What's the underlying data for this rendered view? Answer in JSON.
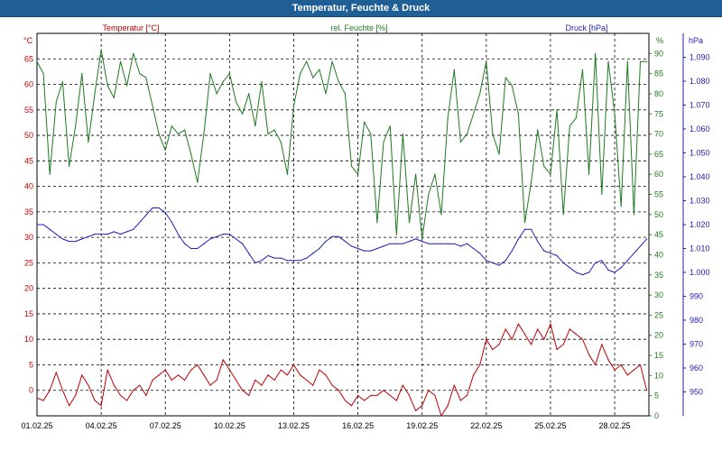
{
  "window": {
    "title": "Temperatur, Feuchte & Druck",
    "title_bg": "#1f5f96"
  },
  "chart_data": {
    "type": "line",
    "x_tick_labels": [
      "01.02.25",
      "04.02.25",
      "07.02.25",
      "10.02.25",
      "13.02.25",
      "16.02.25",
      "19.02.25",
      "22.02.25",
      "25.02.25",
      "28.02.25"
    ],
    "x_range_days": [
      0,
      28.6
    ],
    "grid": true,
    "axes": [
      {
        "id": "temp",
        "side": "left",
        "label": "Temperatur [°C]",
        "unit": "°C",
        "color": "#c00000",
        "ylim": [
          -5,
          70
        ],
        "ticks": [
          0,
          5,
          10,
          15,
          20,
          25,
          30,
          35,
          40,
          45,
          50,
          55,
          60,
          65
        ]
      },
      {
        "id": "hum",
        "side": "right",
        "label": "rel. Feuchte [%]",
        "unit": "%",
        "color": "#1f7a1f",
        "ylim": [
          0,
          95
        ],
        "ticks": [
          0,
          5,
          10,
          15,
          20,
          25,
          30,
          35,
          40,
          45,
          50,
          55,
          60,
          65,
          70,
          75,
          80,
          85,
          90
        ]
      },
      {
        "id": "press",
        "side": "right",
        "label": "Druck [hPa]",
        "unit": "hPa",
        "color": "#1f1fb4",
        "ylim": [
          940,
          1100
        ],
        "ticks": [
          950,
          960,
          970,
          980,
          990,
          1000,
          1010,
          1020,
          1030,
          1040,
          1050,
          1060,
          1070,
          1080,
          1090
        ]
      }
    ],
    "series": [
      {
        "name": "Temperatur [°C]",
        "axis": "temp",
        "color": "#c00000",
        "x": [
          0,
          0.3,
          0.6,
          0.9,
          1.2,
          1.5,
          1.8,
          2.1,
          2.4,
          2.7,
          3,
          3.3,
          3.6,
          3.9,
          4.2,
          4.5,
          4.8,
          5.1,
          5.4,
          5.7,
          6,
          6.3,
          6.6,
          6.9,
          7.2,
          7.5,
          7.8,
          8.1,
          8.4,
          8.7,
          9,
          9.3,
          9.6,
          9.9,
          10.2,
          10.5,
          10.8,
          11.1,
          11.4,
          11.7,
          12,
          12.3,
          12.6,
          12.9,
          13.2,
          13.5,
          13.8,
          14.1,
          14.4,
          14.7,
          15,
          15.3,
          15.6,
          15.9,
          16.2,
          16.5,
          16.8,
          17.1,
          17.4,
          17.7,
          18,
          18.3,
          18.6,
          18.9,
          19.2,
          19.5,
          19.8,
          20.1,
          20.4,
          20.7,
          21,
          21.3,
          21.6,
          21.9,
          22.2,
          22.5,
          22.8,
          23.1,
          23.4,
          23.7,
          24,
          24.3,
          24.6,
          24.9,
          25.2,
          25.5,
          25.8,
          26.1,
          26.4,
          26.7,
          27,
          27.3,
          27.6,
          27.9,
          28.2,
          28.5
        ],
        "values": [
          -1.5,
          -2,
          0,
          3.5,
          0,
          -3,
          -1,
          3,
          1,
          -2,
          -3,
          4,
          1,
          -1,
          -2,
          0,
          1,
          -1,
          2,
          3,
          4,
          2,
          3,
          2,
          4,
          5,
          3,
          1,
          2,
          6,
          4,
          2,
          0,
          -1,
          2,
          1,
          3,
          2,
          4,
          3,
          5,
          3,
          2,
          1,
          4,
          3,
          1,
          0,
          -2,
          -3,
          -1,
          -2,
          -1,
          -1,
          0,
          -1,
          -2,
          1,
          -1,
          -4,
          -3,
          0,
          -1,
          -5,
          -3,
          1,
          -2,
          -1,
          3,
          5,
          10,
          8,
          9,
          12,
          10,
          13,
          11,
          9,
          12,
          10,
          13,
          8,
          9,
          12,
          11,
          10,
          7,
          5,
          9,
          6,
          4,
          5,
          3,
          4,
          5,
          0
        ],
        "point_labels": [
          "-1.5",
          "-2",
          "0",
          "3.5",
          "0",
          "-3",
          "-1",
          "3",
          "1",
          "-2",
          "-3",
          "4",
          "1",
          "-1",
          "-2",
          "0",
          "1",
          "-1",
          "2",
          "3",
          "4",
          "2",
          "3",
          "2",
          "4",
          "5",
          "3",
          "1",
          "2",
          "6",
          "4",
          "2",
          "0",
          "-1",
          "2",
          "1",
          "3",
          "2",
          "4",
          "3",
          "5",
          "3",
          "2",
          "1",
          "4",
          "3",
          "1",
          "0",
          "-2",
          "-3",
          "-1",
          "-2",
          "-1",
          "-1",
          "0",
          "-1",
          "-2",
          "1",
          "-1",
          "-4",
          "-3",
          "0",
          "-1",
          "-5",
          "-3",
          "1",
          "-2",
          "-1",
          "3",
          "5",
          "10",
          "8",
          "9",
          "12",
          "10",
          "13",
          "11",
          "9",
          "12",
          "10",
          "13",
          "8",
          "9",
          "12",
          "11",
          "10",
          "7",
          "5",
          "9",
          "6",
          "4",
          "5",
          "3",
          "4",
          "5",
          "0"
        ]
      },
      {
        "name": "rel. Feuchte [%]",
        "axis": "hum",
        "color": "#1f7a1f",
        "x": [
          0,
          0.3,
          0.6,
          0.9,
          1.2,
          1.5,
          1.8,
          2.1,
          2.4,
          2.7,
          3,
          3.3,
          3.6,
          3.9,
          4.2,
          4.5,
          4.8,
          5.1,
          5.4,
          5.7,
          6,
          6.3,
          6.6,
          6.9,
          7.2,
          7.5,
          7.8,
          8.1,
          8.4,
          8.7,
          9,
          9.3,
          9.6,
          9.9,
          10.2,
          10.5,
          10.8,
          11.1,
          11.4,
          11.7,
          12,
          12.3,
          12.6,
          12.9,
          13.2,
          13.5,
          13.8,
          14.1,
          14.4,
          14.7,
          15,
          15.3,
          15.6,
          15.9,
          16.2,
          16.5,
          16.8,
          17.1,
          17.4,
          17.7,
          18,
          18.3,
          18.6,
          18.9,
          19.2,
          19.5,
          19.8,
          20.1,
          20.4,
          20.7,
          21,
          21.3,
          21.6,
          21.9,
          22.2,
          22.5,
          22.8,
          23.1,
          23.4,
          23.7,
          24,
          24.3,
          24.6,
          24.9,
          25.2,
          25.5,
          25.8,
          26.1,
          26.4,
          26.7,
          27,
          27.3,
          27.6,
          27.9,
          28.2,
          28.5
        ],
        "values": [
          88,
          85,
          60,
          78,
          83,
          62,
          72,
          85,
          68,
          80,
          91,
          82,
          79,
          88,
          82,
          90,
          85,
          84,
          77,
          70,
          66,
          72,
          70,
          71,
          65,
          58,
          70,
          85,
          80,
          83,
          85,
          78,
          75,
          80,
          72,
          83,
          70,
          71,
          68,
          60,
          77,
          85,
          88,
          84,
          86,
          80,
          88,
          83,
          80,
          62,
          60,
          73,
          70,
          48,
          68,
          72,
          45,
          70,
          48,
          60,
          44,
          55,
          60,
          50,
          74,
          86,
          68,
          70,
          75,
          80,
          88,
          70,
          65,
          84,
          82,
          75,
          48,
          58,
          71,
          62,
          60,
          76,
          50,
          72,
          74,
          86,
          60,
          90,
          55,
          88,
          75,
          52,
          88,
          50,
          88,
          88
        ],
        "point_labels": [
          "88",
          "85",
          "60",
          "78",
          "83",
          "62",
          "72",
          "85",
          "68",
          "80",
          "91",
          "82",
          "79",
          "88",
          "82",
          "90",
          "85",
          "84",
          "77",
          "70",
          "66",
          "72",
          "70",
          "71",
          "65",
          "58",
          "70",
          "85",
          "80",
          "83",
          "85",
          "78",
          "75",
          "80",
          "72",
          "83",
          "70",
          "71",
          "68",
          "60",
          "77",
          "85",
          "88",
          "84",
          "86",
          "80",
          "88",
          "83",
          "80",
          "62",
          "60",
          "73",
          "70",
          "48",
          "68",
          "72",
          "45",
          "70",
          "48",
          "60",
          "44",
          "55",
          "60",
          "50",
          "74",
          "86",
          "68",
          "70",
          "75",
          "80",
          "88",
          "70",
          "65",
          "84",
          "82",
          "75",
          "48",
          "58",
          "71",
          "62",
          "60",
          "76",
          "50",
          "72",
          "74",
          "86",
          "60",
          "90",
          "55",
          "88",
          "75",
          "52",
          "88",
          "50",
          "88",
          "88"
        ]
      },
      {
        "name": "Druck [hPa]",
        "axis": "press",
        "color": "#1f1fb4",
        "x": [
          0,
          0.3,
          0.6,
          0.9,
          1.2,
          1.5,
          1.8,
          2.1,
          2.4,
          2.7,
          3,
          3.3,
          3.6,
          3.9,
          4.2,
          4.5,
          4.8,
          5.1,
          5.4,
          5.7,
          6,
          6.3,
          6.6,
          6.9,
          7.2,
          7.5,
          7.8,
          8.1,
          8.4,
          8.7,
          9,
          9.3,
          9.6,
          9.9,
          10.2,
          10.5,
          10.8,
          11.1,
          11.4,
          11.7,
          12,
          12.3,
          12.6,
          12.9,
          13.2,
          13.5,
          13.8,
          14.1,
          14.4,
          14.7,
          15,
          15.3,
          15.6,
          15.9,
          16.2,
          16.5,
          16.8,
          17.1,
          17.4,
          17.7,
          18,
          18.3,
          18.6,
          18.9,
          19.2,
          19.5,
          19.8,
          20.1,
          20.4,
          20.7,
          21,
          21.3,
          21.6,
          21.9,
          22.2,
          22.5,
          22.8,
          23.1,
          23.4,
          23.7,
          24,
          24.3,
          24.6,
          24.9,
          25.2,
          25.5,
          25.8,
          26.1,
          26.4,
          26.7,
          27,
          27.3,
          27.6,
          27.9,
          28.2,
          28.5
        ],
        "values": [
          1020,
          1020,
          1018,
          1016,
          1014,
          1013,
          1013,
          1014,
          1015,
          1016,
          1016,
          1016,
          1017,
          1016,
          1017,
          1018,
          1021,
          1024,
          1027,
          1027,
          1025,
          1021,
          1016,
          1012,
          1010,
          1010,
          1012,
          1014,
          1015,
          1016,
          1016,
          1014,
          1012,
          1008,
          1004,
          1005,
          1007,
          1006,
          1006,
          1005,
          1005,
          1005,
          1006,
          1008,
          1010,
          1013,
          1015,
          1015,
          1013,
          1011,
          1010,
          1009,
          1009,
          1010,
          1011,
          1012,
          1012,
          1012,
          1013,
          1014,
          1013,
          1012,
          1012,
          1012,
          1012,
          1012,
          1011,
          1012,
          1010,
          1008,
          1005,
          1004,
          1003,
          1005,
          1009,
          1014,
          1018,
          1018,
          1013,
          1009,
          1008,
          1007,
          1004,
          1002,
          1000,
          999,
          1000,
          1004,
          1005,
          1001,
          1000,
          1002,
          1005,
          1008,
          1011,
          1014
        ],
        "point_labels": [
          "1020",
          "1020",
          "1018",
          "1016",
          "1014",
          "1013",
          "1013",
          "1014",
          "1015",
          "1016",
          "1016",
          "1016",
          "1017",
          "1016",
          "1017",
          "1018",
          "1021",
          "1024",
          "1027",
          "1027",
          "1025",
          "1021",
          "1016",
          "1012",
          "1010",
          "1010",
          "1012",
          "1014",
          "1015",
          "1016",
          "1016",
          "1014",
          "1012",
          "1008",
          "1004",
          "1005",
          "1007",
          "1006",
          "1006",
          "1005",
          "1005",
          "1005",
          "1006",
          "1008",
          "1010",
          "1013",
          "1015",
          "1015",
          "1013",
          "1011",
          "1010",
          "1009",
          "1009",
          "1010",
          "1011",
          "1012",
          "1012",
          "1012",
          "1013",
          "1014",
          "1013",
          "1012",
          "1012",
          "1012",
          "1012",
          "1012",
          "1011",
          "1012",
          "1010",
          "1008",
          "1005",
          "1004",
          "1003",
          "1005",
          "1009",
          "1014",
          "1018",
          "1018",
          "1013",
          "1009",
          "1008",
          "1007",
          "1004",
          "1002",
          "1000",
          "999",
          "1000",
          "1004",
          "1005",
          "1001",
          "1000",
          "1002",
          "1005",
          "1008",
          "1011",
          "1014"
        ]
      }
    ]
  }
}
